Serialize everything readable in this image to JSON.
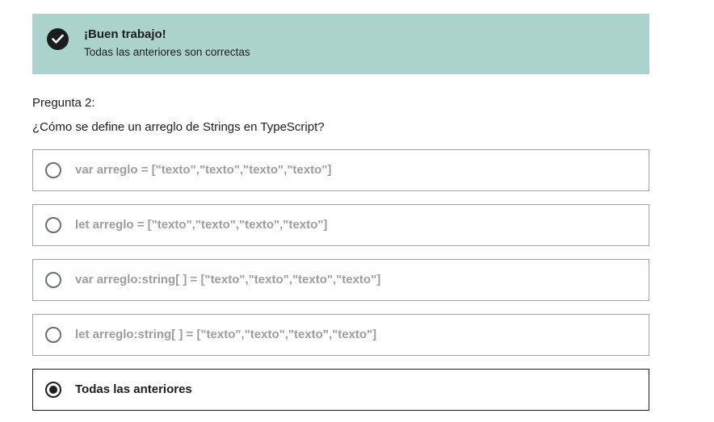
{
  "feedback": {
    "title": "¡Buen trabajo!",
    "message": "Todas las anteriores son correctas",
    "icon": "check-circle-icon",
    "background_color": "#acd2cc"
  },
  "question": {
    "number_label": "Pregunta 2:",
    "text": "¿Cómo se define un arreglo de Strings en TypeScript?"
  },
  "options": [
    {
      "label": "var arreglo = [\"texto\",\"texto\",\"texto\",\"texto\"]",
      "selected": false
    },
    {
      "label": "let arreglo = [\"texto\",\"texto\",\"texto\",\"texto\"]",
      "selected": false
    },
    {
      "label": "var arreglo:string[ ] = [\"texto\",\"texto\",\"texto\",\"texto\"]",
      "selected": false
    },
    {
      "label": "let arreglo:string[ ] = [\"texto\",\"texto\",\"texto\",\"texto\"]",
      "selected": false
    },
    {
      "label": "Todas las anteriores",
      "selected": true
    }
  ]
}
